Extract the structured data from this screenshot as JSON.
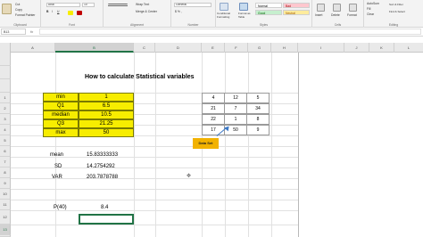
{
  "ribbon": {
    "clipboard": [
      "Cut",
      "Copy",
      "Format Painter"
    ],
    "font_name": "Arial",
    "font_size": "10",
    "wrap_text": "Wrap Text",
    "merge_center": "Merge & Center",
    "number_format": "General",
    "conditional_formatting": "Conditional Formatting",
    "format_as_table": "Format as Table",
    "styles": [
      "Normal",
      "Bad",
      "Good",
      "Neutral"
    ],
    "cells": [
      "Insert",
      "Delete",
      "Format"
    ],
    "editing": [
      "AutoSum",
      "Fill",
      "Clear",
      "Sort & Filter",
      "Find & Select"
    ],
    "group_labels": [
      "Clipboard",
      "Font",
      "Alignment",
      "Number",
      "Styles",
      "Cells",
      "Editing"
    ]
  },
  "formula_bar": {
    "name_box": "B13",
    "fx": "fx",
    "value": ""
  },
  "columns": [
    "A",
    "B",
    "C",
    "D",
    "E",
    "F",
    "G",
    "H",
    "I",
    "J",
    "K",
    "L"
  ],
  "selected_column": "B",
  "rows": [
    "",
    "",
    "",
    "1",
    "2",
    "3",
    "4",
    "5",
    "6",
    "7",
    "8",
    "9",
    "10",
    "11",
    "12",
    "13",
    "14"
  ],
  "selected_row": "13",
  "sheet": {
    "title": "How to calculate Statistical variables",
    "summary": [
      {
        "label": "min",
        "value": "1"
      },
      {
        "label": "Q1",
        "value": "6.5"
      },
      {
        "label": "median",
        "value": "10.5"
      },
      {
        "label": "Q3",
        "value": "21.25"
      },
      {
        "label": "max",
        "value": "50"
      }
    ],
    "stats": [
      {
        "label": "mean",
        "value": "15.83333333"
      },
      {
        "label": "SD",
        "value": "14.2754292"
      },
      {
        "label": "VAR",
        "value": "203.7878788"
      }
    ],
    "percentile": {
      "label": "P(40)",
      "value": "8.4"
    },
    "data_set": [
      [
        "4",
        "12",
        "5"
      ],
      [
        "21",
        "7",
        "34"
      ],
      [
        "22",
        "1",
        "8"
      ],
      [
        "17",
        "50",
        "9"
      ]
    ],
    "callout": "Data Set"
  },
  "colors": {
    "yellow": "#f7ed00",
    "excel_green": "#217346",
    "callout_orange": "#f2b200",
    "arrow_blue": "#3b78c6"
  }
}
